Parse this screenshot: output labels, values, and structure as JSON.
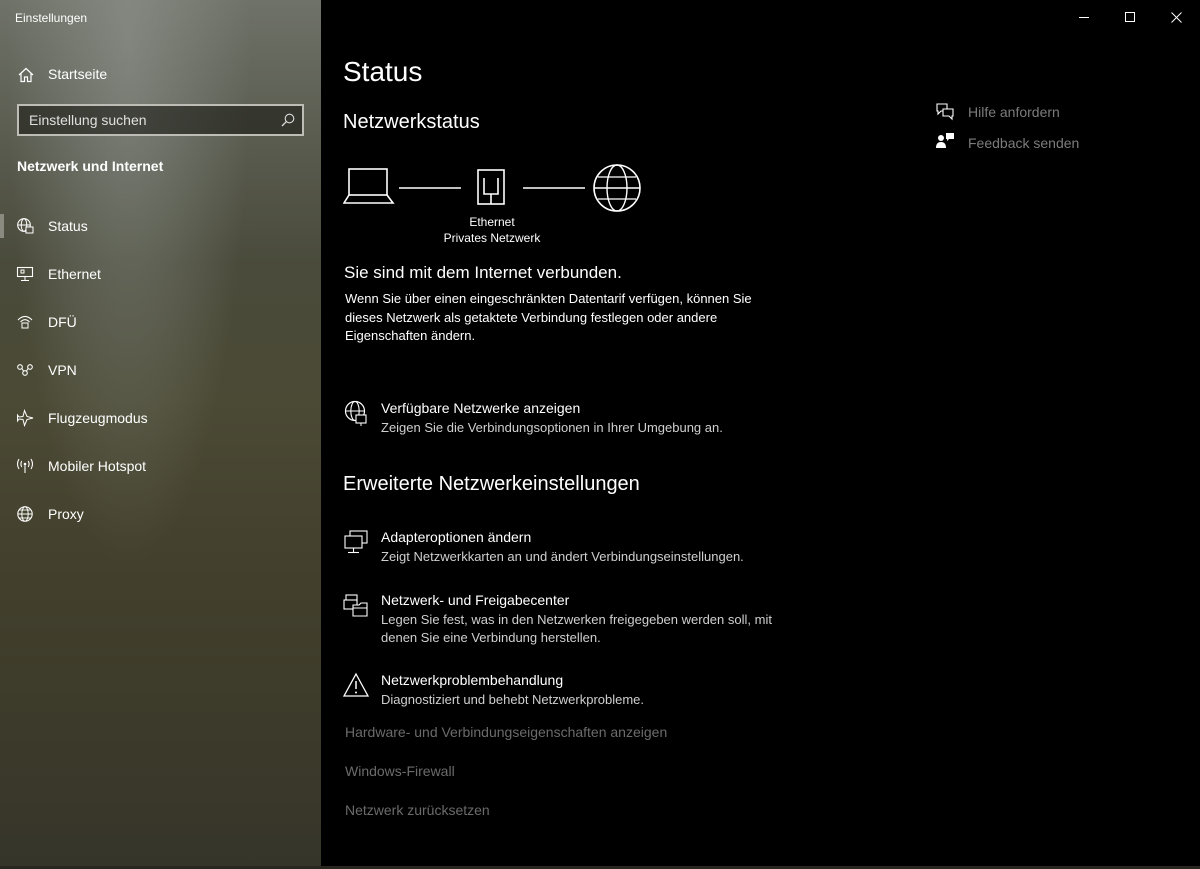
{
  "window": {
    "title": "Einstellungen"
  },
  "sidebar": {
    "home_label": "Startseite",
    "search_placeholder": "Einstellung suchen",
    "section_title": "Netzwerk und Internet",
    "items": [
      {
        "label": "Status",
        "icon": "globe-status-icon",
        "active": true
      },
      {
        "label": "Ethernet",
        "icon": "ethernet-icon"
      },
      {
        "label": "DFÜ",
        "icon": "dial-up-icon"
      },
      {
        "label": "VPN",
        "icon": "vpn-icon"
      },
      {
        "label": "Flugzeugmodus",
        "icon": "airplane-icon"
      },
      {
        "label": "Mobiler Hotspot",
        "icon": "hotspot-icon"
      },
      {
        "label": "Proxy",
        "icon": "globe-icon"
      }
    ]
  },
  "main": {
    "title": "Status",
    "network_status_heading": "Netzwerkstatus",
    "diagram": {
      "connection_name": "Ethernet",
      "network_type": "Privates Netzwerk"
    },
    "connected_text": "Sie sind mit dem Internet verbunden.",
    "description": "Wenn Sie über einen eingeschränkten Datentarif verfügen, können Sie dieses Netzwerk als getaktete Verbindung festlegen oder andere Eigenschaften ändern.",
    "available_networks": {
      "title": "Verfügbare Netzwerke anzeigen",
      "desc": "Zeigen Sie die Verbindungsoptionen in Ihrer Umgebung an."
    },
    "advanced_heading": "Erweiterte Netzwerkeinstellungen",
    "advanced_items": [
      {
        "title": "Adapteroptionen ändern",
        "desc": "Zeigt Netzwerkkarten an und ändert Verbindungseinstellungen.",
        "icon": "adapter-icon"
      },
      {
        "title": "Netzwerk- und Freigabecenter",
        "desc": "Legen Sie fest, was in den Netzwerken freigegeben werden soll, mit denen Sie eine Verbindung herstellen.",
        "icon": "sharing-center-icon"
      },
      {
        "title": "Netzwerkproblembehandlung",
        "desc": "Diagnostiziert und behebt Netzwerkprobleme.",
        "icon": "warning-icon"
      }
    ],
    "links": [
      "Hardware- und Verbindungseigenschaften anzeigen",
      "Windows-Firewall",
      "Netzwerk zurücksetzen"
    ]
  },
  "help": {
    "get_help": "Hilfe anfordern",
    "feedback": "Feedback senden"
  },
  "colors": {
    "background": "#000000",
    "text": "#ffffff",
    "secondary_text": "#cfcfcf",
    "disabled_link": "#6b6b6b"
  }
}
